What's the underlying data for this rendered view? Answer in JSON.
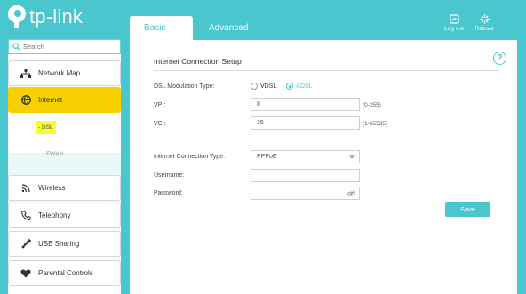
{
  "brand": {
    "name": "tp-link"
  },
  "tabs": [
    {
      "label": "Basic"
    },
    {
      "label": "Advanced"
    }
  ],
  "top_actions": {
    "logout": {
      "label": "Log out",
      "icon": "logout-icon"
    },
    "reboot": {
      "label": "Reboot",
      "icon": "reboot-icon"
    }
  },
  "sidebar": {
    "search_placeholder": "Search",
    "items": [
      {
        "label": "Network Map",
        "icon": "network-map-icon"
      },
      {
        "label": "Internet",
        "icon": "globe-icon",
        "selected": true
      },
      {
        "label": "Wireless",
        "icon": "wireless-icon"
      },
      {
        "label": "Telephony",
        "icon": "phone-icon"
      },
      {
        "label": "USB Sharing",
        "icon": "usb-icon"
      },
      {
        "label": "Parental Controls",
        "icon": "heart-icon"
      }
    ],
    "sub_items": [
      {
        "label": "- DSL",
        "current": true
      },
      {
        "label": "- EWAN"
      }
    ]
  },
  "main": {
    "section_title": "Internet Connection Setup",
    "dsl_modulation": {
      "label": "DSL Modulation Type:",
      "options": [
        "VDSL",
        "ADSL"
      ],
      "selected": "ADSL"
    },
    "vpi": {
      "label": "VPI:",
      "value": "8",
      "hint": "(0-255)"
    },
    "vci": {
      "label": "VCI:",
      "value": "35",
      "hint": "(1-65535)"
    },
    "connection_type": {
      "label": "Internet Connection Type:",
      "value": "PPPoE"
    },
    "username": {
      "label": "Username:",
      "value": ""
    },
    "password": {
      "label": "Password:",
      "value": ""
    },
    "save_label": "Save"
  },
  "colors": {
    "accent": "#4ac6cf",
    "selected": "#f6d000",
    "highlight": "#f5ff33"
  }
}
